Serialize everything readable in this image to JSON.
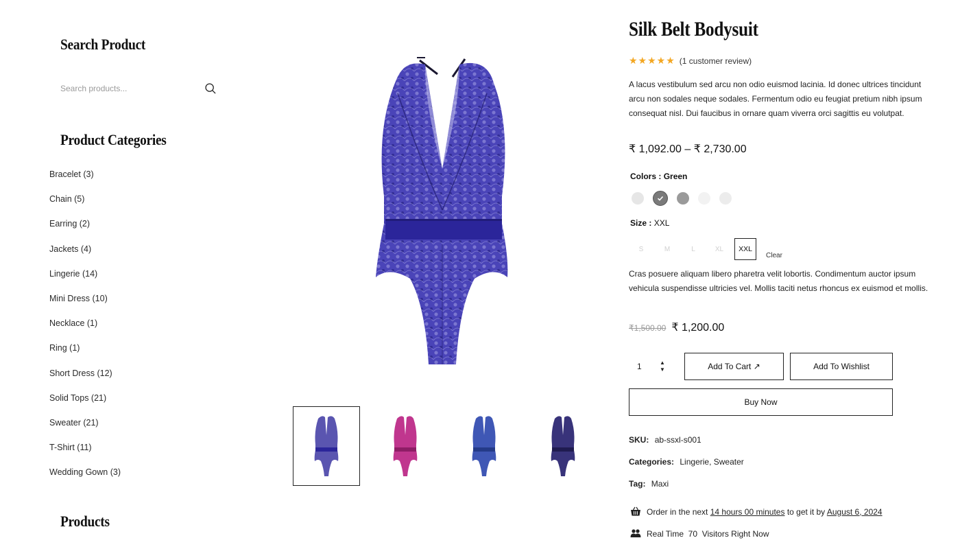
{
  "sidebar": {
    "search_title": "Search Product",
    "search_placeholder": "Search products...",
    "categories_title": "Product Categories",
    "categories": [
      "Bracelet (3)",
      "Chain (5)",
      "Earring (2)",
      "Jackets (4)",
      "Lingerie (14)",
      "Mini Dress (10)",
      "Necklace (1)",
      "Ring (1)",
      "Short Dress (12)",
      "Solid Tops (21)",
      "Sweater (21)",
      "T-Shirt (11)",
      "Wedding Gown (3)"
    ],
    "products_title": "Products"
  },
  "gallery": {
    "main_color": "#3b35a8",
    "thumbnail_colors": [
      "#5a55b0",
      "#c0368e",
      "#3f57b5",
      "#38337a"
    ]
  },
  "product": {
    "title": "Silk Belt Bodysuit",
    "rating_stars": "★★★★★",
    "rating_value": 5,
    "review_text": "(1 customer review)",
    "description": "A lacus vestibulum sed arcu non odio euismod lacinia. Id donec ultrices tincidunt arcu non sodales neque sodales. Fermentum odio eu feugiat pretium nibh ipsum consequat nisl. Dui faucibus in ornare quam viverra orci sagittis eu volutpat.",
    "price_range": "₹ 1,092.00 – ₹ 2,730.00",
    "colors_label": "Colors :",
    "colors_value": "Green",
    "swatch_colors": [
      "#e6e6e6",
      "#7a7a7a",
      "#9a9a9a",
      "#f2f2f2",
      "#ececec"
    ],
    "size_label": "Size :",
    "size_value": "XXL",
    "sizes": [
      "S",
      "M",
      "L",
      "XL",
      "XXL"
    ],
    "clear_label": "Clear",
    "variation_description": "Cras posuere aliquam libero pharetra velit lobortis. Condimentum auctor ipsum vehicula suspendisse ultricies vel. Mollis taciti netus rhoncus ex euismod et mollis.",
    "old_price": "₹1,500.00",
    "sale_price": "₹ 1,200.00",
    "quantity": "1",
    "add_to_cart_label": "Add To Cart ↗",
    "add_to_wishlist_label": "Add To Wishlist",
    "buy_now_label": "Buy Now",
    "sku_label": "SKU:",
    "sku_value": "ab-ssxl-s001",
    "categories_label": "Categories:",
    "categories_value": "Lingerie, Sweater",
    "tag_label": "Tag:",
    "tag_value": "Maxi",
    "delivery_prefix": "Order in the next",
    "delivery_time": "14 hours 00 minutes",
    "delivery_middle": "to get it by",
    "delivery_date": "August 6, 2024",
    "visitors_text": "Real Time  70  Visitors Right Now"
  }
}
